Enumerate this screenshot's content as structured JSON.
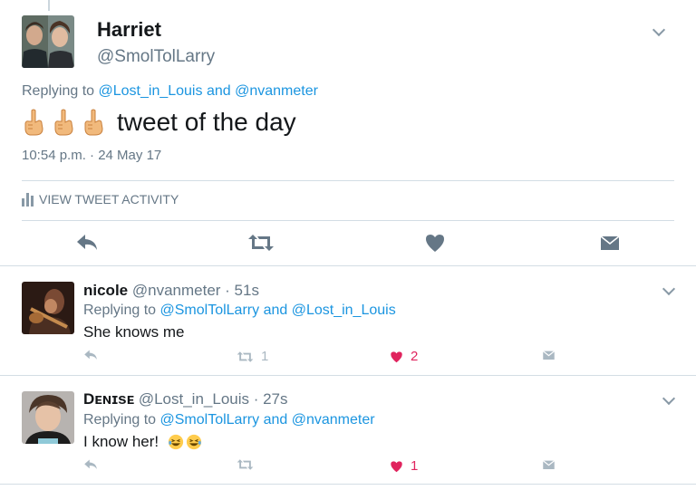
{
  "main_tweet": {
    "name": "Harriet",
    "handle": "@SmolTolLarry",
    "replying_prefix": "Replying to",
    "replying_user1": "@Lost_in_Louis",
    "replying_and": "and",
    "replying_user2": "@nvanmeter",
    "emoji": [
      "point-up-hand-emoji",
      "point-up-hand-emoji",
      "point-up-hand-emoji"
    ],
    "text": "tweet of the day",
    "timestamp": "10:54 p.m. · 24 May 17",
    "activity_label": "VIEW TWEET ACTIVITY",
    "actions": [
      "reply-icon",
      "retweet-icon",
      "like-icon",
      "direct-message-icon"
    ]
  },
  "replies": [
    {
      "name": "nicole",
      "handle": "@nvanmeter · 51s",
      "replying_prefix": "Replying to",
      "replying_user1": "@SmolTolLarry",
      "replying_and": "and",
      "replying_user2": "@Lost_in_Louis",
      "text": "She knows me",
      "retweets": "1",
      "likes": "2"
    },
    {
      "name": "Dᴇɴɪsᴇ",
      "handle": "@Lost_in_Louis · 27s",
      "replying_prefix": "Replying to",
      "replying_user1": "@SmolTolLarry",
      "replying_and": "and",
      "replying_user2": "@nvanmeter",
      "text": "I know her!",
      "emoji": [
        "laughing-emoji",
        "laughing-emoji"
      ],
      "likes": "1"
    }
  ],
  "colors": {
    "link": "#1b95e0",
    "secondary_text": "#657786",
    "like_active": "#e0245e",
    "icon": "#8899a6",
    "divider": "#d3dde4"
  }
}
